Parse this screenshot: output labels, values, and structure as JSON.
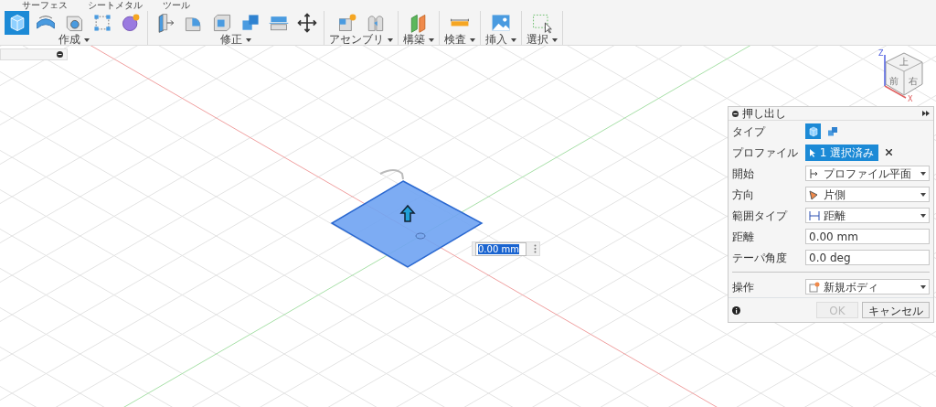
{
  "toolbar": {
    "tabs": [
      "サーフェス",
      "シートメタル",
      "ツール"
    ],
    "groups": [
      {
        "label": "作成",
        "tools": [
          {
            "kind": "box",
            "selected": true
          },
          {
            "kind": "surface",
            "selected": false
          },
          {
            "kind": "hole",
            "selected": false
          },
          {
            "kind": "sketch",
            "selected": false
          },
          {
            "kind": "form",
            "selected": false
          }
        ]
      },
      {
        "label": "修正",
        "tools": [
          {
            "kind": "pushpull",
            "selected": false
          },
          {
            "kind": "fillet",
            "selected": false
          },
          {
            "kind": "shell",
            "selected": false
          },
          {
            "kind": "combine",
            "selected": false
          },
          {
            "kind": "split",
            "selected": false
          },
          {
            "kind": "move",
            "selected": false
          }
        ]
      },
      {
        "label": "アセンブリ",
        "tools": [
          {
            "kind": "component",
            "selected": false
          },
          {
            "kind": "joint",
            "selected": false
          }
        ]
      },
      {
        "label": "構築",
        "tools": [
          {
            "kind": "plane",
            "selected": false
          }
        ]
      },
      {
        "label": "検査",
        "tools": [
          {
            "kind": "measure",
            "selected": false
          }
        ]
      },
      {
        "label": "挿入",
        "tools": [
          {
            "kind": "image",
            "selected": false
          }
        ]
      },
      {
        "label": "選択",
        "tools": [
          {
            "kind": "select",
            "selected": false
          }
        ]
      }
    ]
  },
  "viewcube": {
    "top": "上",
    "front": "前",
    "right": "右",
    "axis_z": "Z",
    "axis_x": "X"
  },
  "distance_input": {
    "value": "0.00 mm",
    "selected": true
  },
  "panel": {
    "title": "押し出し",
    "rows": [
      {
        "kind": "type",
        "label": "タイプ",
        "options": [
          {
            "selected": true
          },
          {
            "selected": false
          }
        ]
      },
      {
        "kind": "selection",
        "label": "プロファイル",
        "value": "1 選択済み"
      },
      {
        "kind": "dropdown",
        "label": "開始",
        "value": "プロファイル平面"
      },
      {
        "kind": "dropdown",
        "label": "方向",
        "value": "片側"
      },
      {
        "kind": "dropdown",
        "label": "範囲タイプ",
        "value": "距離"
      },
      {
        "kind": "input",
        "label": "距離",
        "value": "0.00 mm"
      },
      {
        "kind": "input",
        "label": "テーパ角度",
        "value": "0.0 deg"
      },
      {
        "kind": "divider"
      },
      {
        "kind": "dropdown",
        "label": "操作",
        "value": "新規ボディ"
      }
    ],
    "buttons": [
      {
        "label": "OK",
        "disabled": true
      },
      {
        "label": "キャンセル",
        "disabled": false
      }
    ]
  }
}
